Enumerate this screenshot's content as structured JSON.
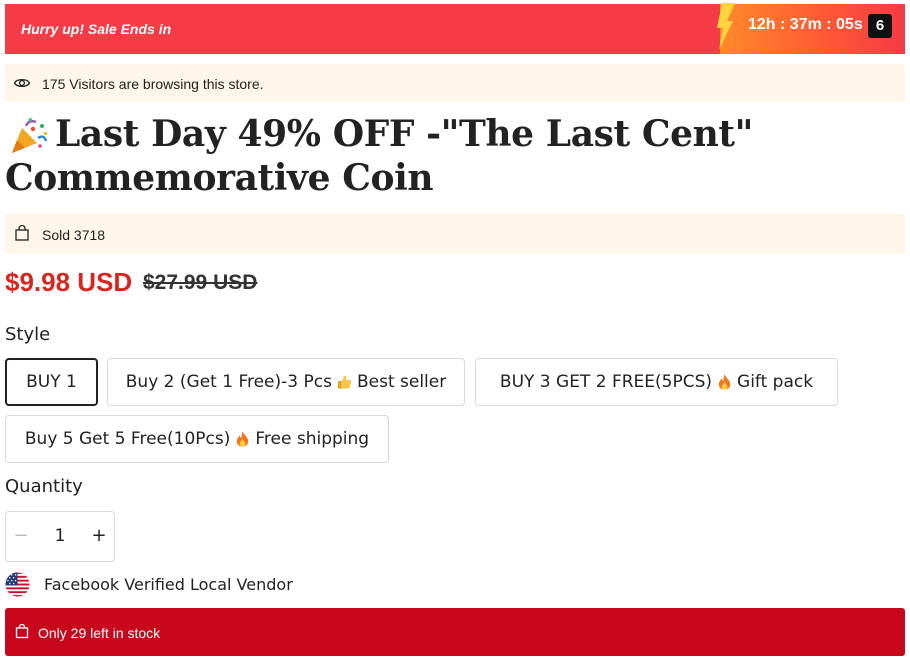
{
  "sale_banner": {
    "message": "Hurry up! Sale Ends in",
    "countdown": "12h : 37m : 05s",
    "countdown_extra": "6"
  },
  "visitors": {
    "text": "175 Visitors are browsing this store.",
    "icon": "eye-icon"
  },
  "product": {
    "title_emoji": "party-popper-icon",
    "title": "Last Day 49% OFF -\"The Last Cent\" Commemorative Coin"
  },
  "sold": {
    "text": "Sold 3718",
    "icon": "shopping-bag-icon"
  },
  "pricing": {
    "price": "$9.98 USD",
    "compare_price": "$27.99 USD"
  },
  "style": {
    "label": "Style",
    "options": [
      {
        "pre": "BUY 1",
        "emoji": "",
        "post": ""
      },
      {
        "pre": "Buy 2 (Get 1 Free)-3 Pcs",
        "emoji": "thumbs-up-icon",
        "post": "Best seller"
      },
      {
        "pre": "BUY 3 GET 2 FREE(5PCS)",
        "emoji": "fire-icon",
        "post": "Gift pack"
      },
      {
        "pre": "Buy 5 Get 5 Free(10Pcs)",
        "emoji": "fire-icon",
        "post": "Free shipping"
      }
    ],
    "selected_index": 0
  },
  "quantity": {
    "label": "Quantity",
    "value": "1",
    "minus": "−",
    "plus": "+"
  },
  "vendor": {
    "text": "Facebook Verified Local Vendor",
    "icon": "us-flag-icon"
  },
  "stock": {
    "text": "Only 29 left in stock",
    "icon": "shopping-bag-icon"
  },
  "colors": {
    "banner_red": "#f53b46",
    "price_red": "#d5261f",
    "stock_red": "#c8071d",
    "strip_cream": "#fdf6e9"
  }
}
